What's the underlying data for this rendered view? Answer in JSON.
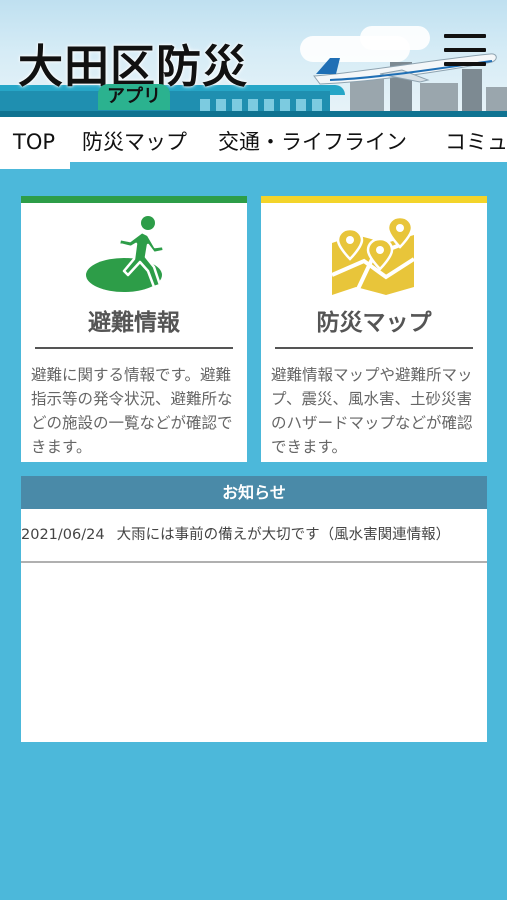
{
  "header": {
    "title": "大田区防災",
    "badge": "アプリ",
    "menu_icon": "hamburger-menu-icon"
  },
  "tabs": [
    {
      "label": "TOP",
      "active": true
    },
    {
      "label": "防災マップ",
      "active": false
    },
    {
      "label": "交通・ライフライン",
      "active": false
    },
    {
      "label": "コミュ",
      "active": false
    }
  ],
  "cards": [
    {
      "title": "避難情報",
      "description": "避難に関する情報です。避難指示等の発令状況、避難所などの施設の一覧などが確認できます。",
      "icon": "evacuation-runner-icon",
      "accent": "#2d9d48"
    },
    {
      "title": "防災マップ",
      "description": "避難情報マップや避難所マップ、震災、風水害、土砂災害のハザードマップなどが確認できます。",
      "icon": "map-pins-icon",
      "accent": "#f3d42a"
    }
  ],
  "notices": {
    "heading": "お知らせ",
    "items": [
      {
        "date": "2021/06/24",
        "text": "大雨には事前の備えが大切です（風水害関連情報）"
      }
    ]
  },
  "colors": {
    "background": "#4cb8da",
    "notice_header": "#4a8aa8"
  }
}
